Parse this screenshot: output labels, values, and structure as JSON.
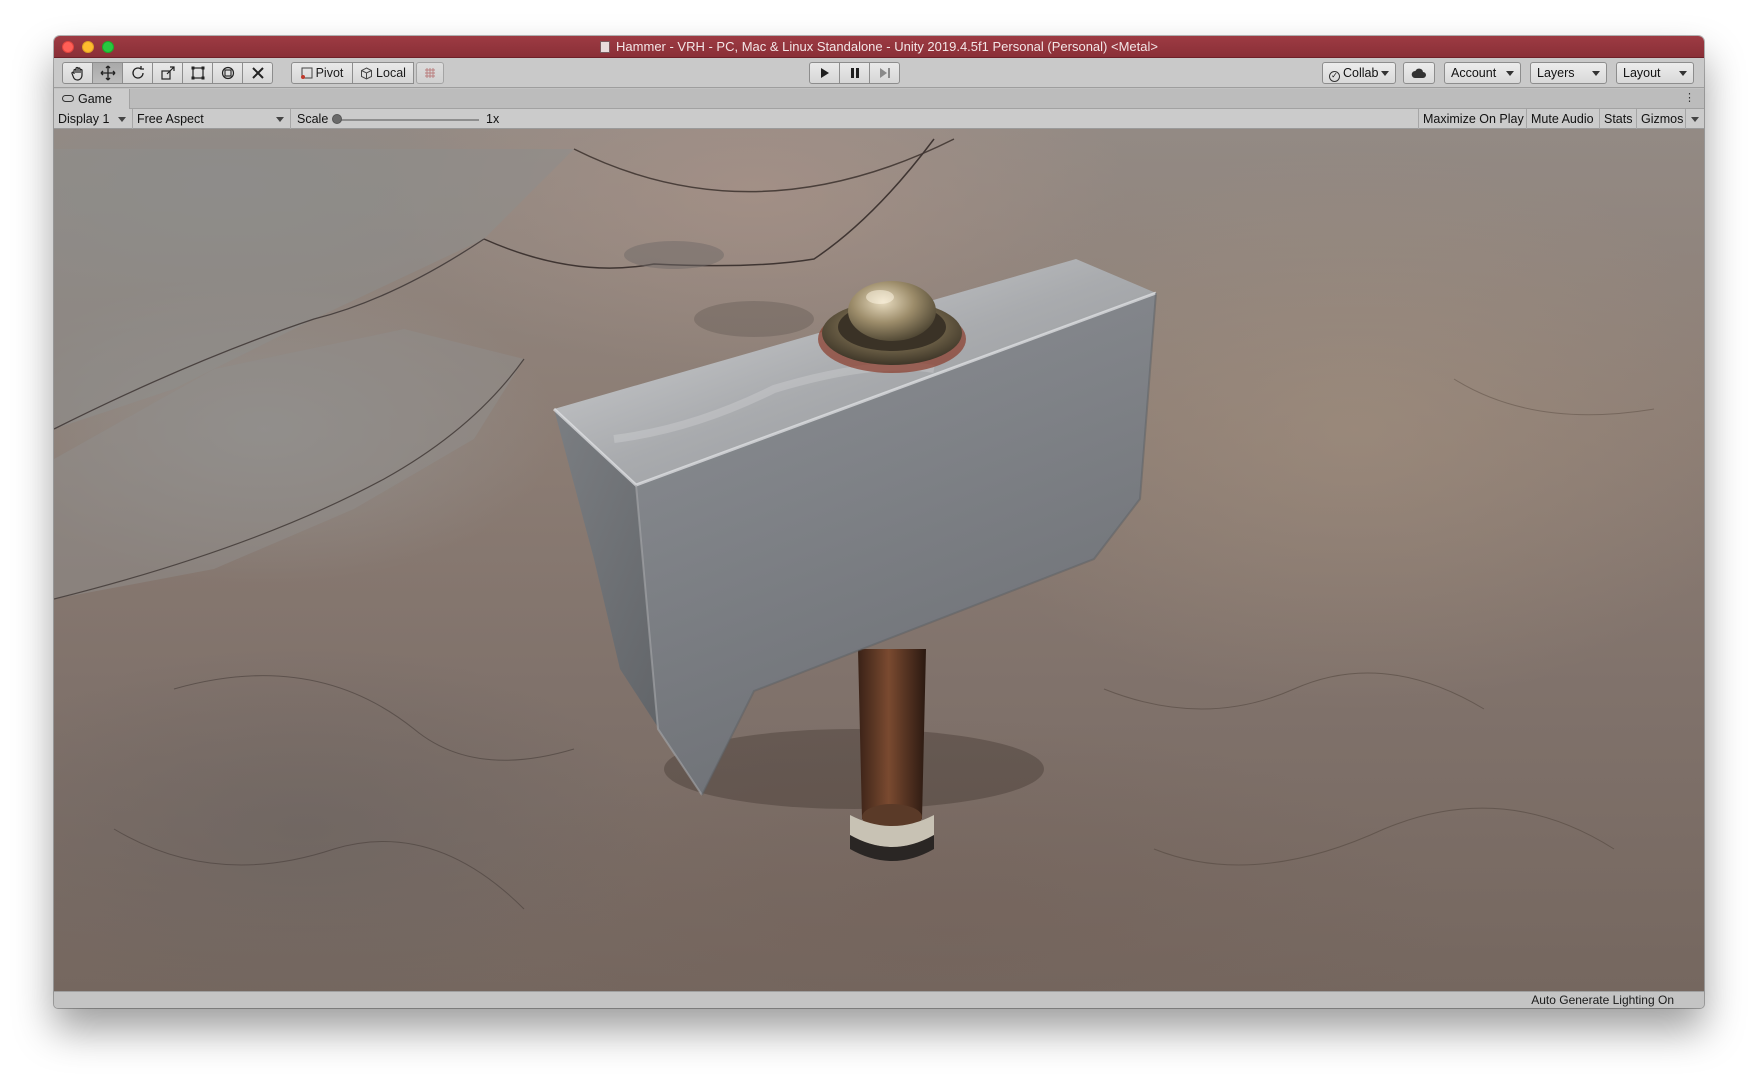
{
  "window": {
    "title": "Hammer - VRH - PC, Mac & Linux Standalone - Unity 2019.4.5f1 Personal (Personal) <Metal>",
    "title_color": "#8e323a"
  },
  "toolbar": {
    "transform_tools": [
      {
        "name": "hand-tool",
        "glyph": "✋"
      },
      {
        "name": "move-tool",
        "glyph": "✥"
      },
      {
        "name": "rotate-tool",
        "glyph": "⟳"
      },
      {
        "name": "scale-tool",
        "glyph": "⤢"
      },
      {
        "name": "rect-tool",
        "glyph": "⬚"
      },
      {
        "name": "transform-tool",
        "glyph": "⊛"
      },
      {
        "name": "custom-tool",
        "glyph": "✕"
      }
    ],
    "pivot_label": "Pivot",
    "local_label": "Local",
    "play_controls": [
      "play",
      "pause",
      "step"
    ],
    "collab_label": "Collab",
    "account_label": "Account",
    "layers_label": "Layers",
    "layout_label": "Layout"
  },
  "game_tab": {
    "label": "Game"
  },
  "game_bar": {
    "display": "Display 1",
    "aspect": "Free Aspect",
    "scale_label": "Scale",
    "scale_value": "1x",
    "maximize_on_play": "Maximize On Play",
    "mute_audio": "Mute Audio",
    "stats": "Stats",
    "gizmos": "Gizmos"
  },
  "status_bar": {
    "text": "Auto Generate Lighting On"
  }
}
